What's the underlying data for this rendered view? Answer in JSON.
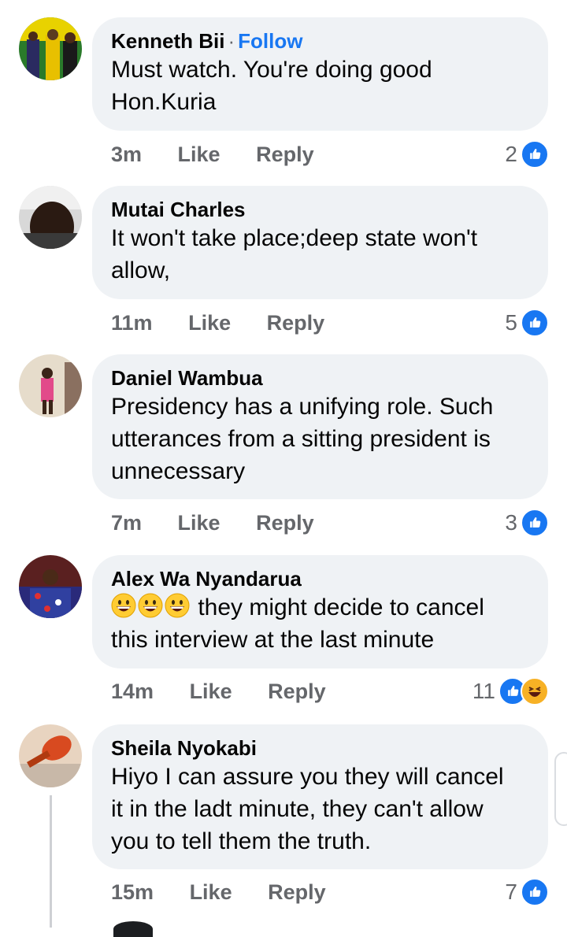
{
  "actions": {
    "like": "Like",
    "reply": "Reply"
  },
  "comments": [
    {
      "author": "Kenneth Bii",
      "follow": "Follow",
      "text_lines": [
        "Must watch. You're doing good",
        "Hon.Kuria"
      ],
      "time": "3m",
      "reactions": "2",
      "reaction_types": [
        "like-icon"
      ]
    },
    {
      "author": "Mutai Charles",
      "text_lines": [
        "It won't take place;deep state won't",
        "allow,"
      ],
      "time": "11m",
      "reactions": "5",
      "reaction_types": [
        "like-icon"
      ]
    },
    {
      "author": "Daniel Wambua",
      "text_lines": [
        "Presidency has a unifying role.  Such",
        "utterances from a sitting president is",
        "unnecessary"
      ],
      "time": "7m",
      "reactions": "3",
      "reaction_types": [
        "like-icon"
      ]
    },
    {
      "author": "Alex Wa Nyandarua",
      "text_prefix_emojis": [
        "grinning-face-emoji",
        "grinning-face-emoji",
        "grinning-face-emoji"
      ],
      "text_lines": [
        "they might decide to cancel",
        "this interview at the last minute"
      ],
      "time": "14m",
      "reactions": "11",
      "reaction_types": [
        "like-icon",
        "haha-icon"
      ]
    },
    {
      "author": "Sheila Nyokabi",
      "text_lines": [
        "Hiyo I can assure you they will cancel",
        "it in the ladt minute, they can't allow",
        "you to tell them the truth."
      ],
      "time": "15m",
      "reactions": "7",
      "reaction_types": [
        "like-icon"
      ]
    }
  ],
  "colors": {
    "bubble": "#eff2f5",
    "accent": "#1877f2",
    "meta": "#65676b",
    "haha": "#f7b125"
  }
}
